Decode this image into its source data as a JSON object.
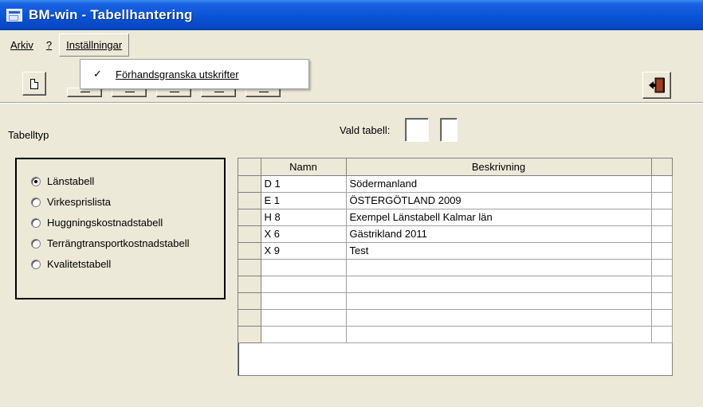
{
  "window": {
    "title": "BM-win - Tabellhantering"
  },
  "menubar": {
    "items": [
      {
        "label": "Arkiv"
      },
      {
        "label": "?"
      },
      {
        "label": "Inställningar"
      }
    ]
  },
  "dropdown": {
    "items": [
      {
        "label": "Förhandsgranska utskrifter",
        "checked": true
      }
    ]
  },
  "toolbar": {
    "buttons": [
      {
        "icon": "new-document-icon"
      },
      {
        "icon": "exit-door-icon"
      }
    ]
  },
  "main": {
    "tabelltyp_label": "Tabelltyp",
    "vald_tabell_label": "Vald tabell:",
    "vald_tabell_values": [
      "",
      ""
    ],
    "radio_options": [
      {
        "label": "Länstabell",
        "checked": true
      },
      {
        "label": "Virkesprislista",
        "checked": false
      },
      {
        "label": "Huggningskostnadstabell",
        "checked": false
      },
      {
        "label": "Terrängtransportkostnadstabell",
        "checked": false
      },
      {
        "label": "Kvalitetstabell",
        "checked": false
      }
    ],
    "grid": {
      "headers": [
        "Namn",
        "Beskrivning"
      ],
      "rows": [
        {
          "namn": "D 1",
          "beskrivning": "Södermanland"
        },
        {
          "namn": "E 1",
          "beskrivning": "ÖSTERGÖTLAND 2009"
        },
        {
          "namn": "H 8",
          "beskrivning": "Exempel Länstabell Kalmar län"
        },
        {
          "namn": "X 6",
          "beskrivning": "Gästrikland 2011"
        },
        {
          "namn": "X 9",
          "beskrivning": "Test"
        },
        {
          "namn": "",
          "beskrivning": ""
        },
        {
          "namn": "",
          "beskrivning": ""
        },
        {
          "namn": "",
          "beskrivning": ""
        },
        {
          "namn": "",
          "beskrivning": ""
        },
        {
          "namn": "",
          "beskrivning": ""
        }
      ]
    }
  }
}
